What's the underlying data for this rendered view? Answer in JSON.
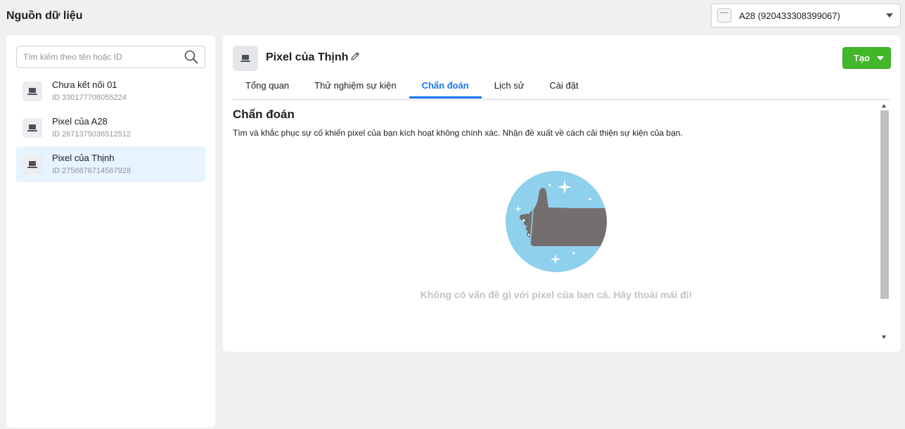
{
  "header": {
    "title": "Nguồn dữ liệu",
    "account_selector": "A28 (920433308399067)"
  },
  "sidebar": {
    "search_placeholder": "Tìm kiếm theo tên hoặc ID",
    "items": [
      {
        "name": "Chưa kết nối 01",
        "id": "ID 330177708055224",
        "selected": false
      },
      {
        "name": "Pixel của A28",
        "id": "ID 2671375036512512",
        "selected": false
      },
      {
        "name": "Pixel của Thịnh",
        "id": "ID 2756876714567928",
        "selected": true
      }
    ]
  },
  "main": {
    "title": "Pixel của Thịnh",
    "create_label": "Tạo",
    "tabs": [
      {
        "label": "Tổng quan",
        "active": false
      },
      {
        "label": "Thử nghiệm sự kiện",
        "active": false
      },
      {
        "label": "Chẩn đoán",
        "active": true
      },
      {
        "label": "Lịch sử",
        "active": false
      },
      {
        "label": "Cài đặt",
        "active": false
      }
    ],
    "section_title": "Chẩn đoán",
    "section_description": "Tìm và khắc phục sự cố khiến pixel của bạn kích hoạt không chính xác. Nhận đề xuất về cách cải thiện sự kiện của bạn.",
    "empty_message": "Không có vấn đề gì với pixel của bạn cả. Hãy thoải mái đi!",
    "illustration": "thumbs-up-icon"
  },
  "colors": {
    "accent": "#1877f2",
    "create_button": "#42b72a",
    "selected_item_bg": "#e7f3ff",
    "illustration_circle": "#8fd0ec",
    "illustration_hand": "#756e6e"
  }
}
